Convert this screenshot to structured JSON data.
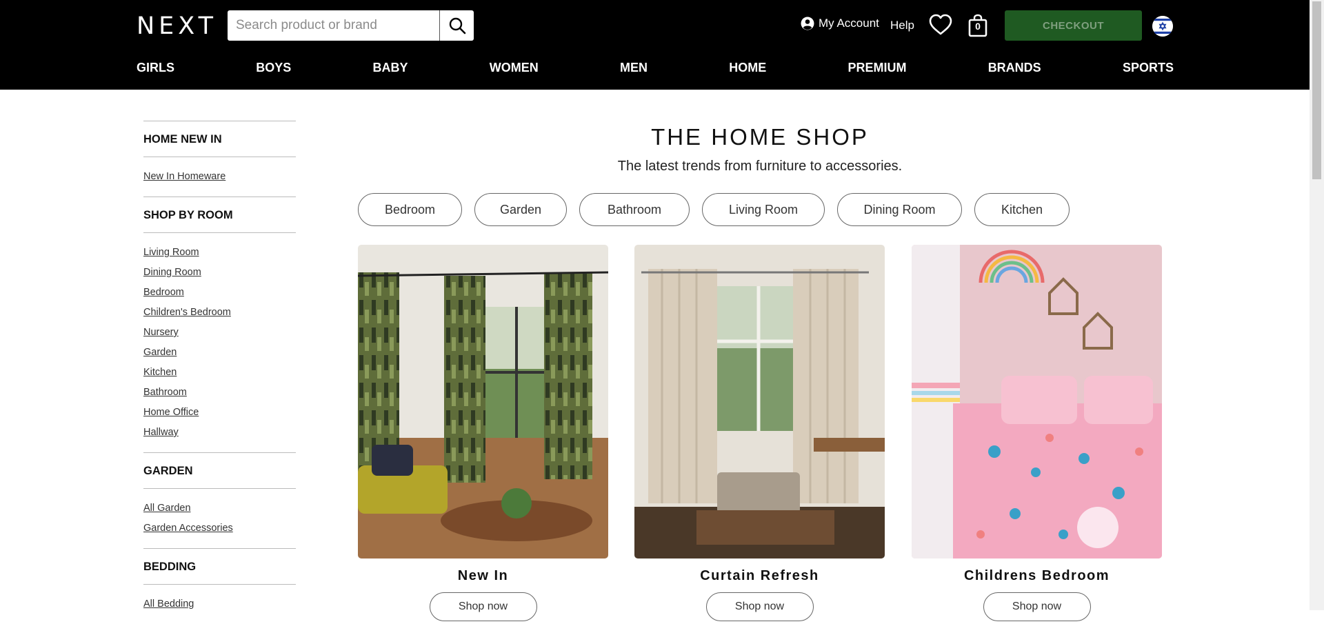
{
  "header": {
    "logo": "NEXT",
    "search_placeholder": "Search product or brand",
    "account_label": "My Account",
    "help_label": "Help",
    "bag_count": "0",
    "checkout_label": "CHECKOUT",
    "nav": [
      "GIRLS",
      "BOYS",
      "BABY",
      "WOMEN",
      "MEN",
      "HOME",
      "PREMIUM",
      "BRANDS",
      "SPORTS"
    ]
  },
  "sidebar": {
    "sections": [
      {
        "heading": "HOME NEW IN",
        "links": [
          "New In Homeware"
        ]
      },
      {
        "heading": "SHOP BY ROOM",
        "links": [
          "Living Room",
          "Dining Room",
          "Bedroom",
          "Children's Bedroom",
          "Nursery",
          "Garden",
          "Kitchen",
          "Bathroom",
          "Home Office",
          "Hallway"
        ]
      },
      {
        "heading": "GARDEN",
        "links": [
          "All Garden",
          "Garden Accessories"
        ]
      },
      {
        "heading": "BEDDING",
        "links": [
          "All Bedding"
        ]
      }
    ]
  },
  "main": {
    "title": "THE HOME SHOP",
    "subtitle": "The latest trends from furniture to accessories.",
    "chips": [
      "Bedroom",
      "Garden",
      "Bathroom",
      "Living Room",
      "Dining Room",
      "Kitchen"
    ],
    "cards": [
      {
        "title": "New In",
        "button": "Shop now"
      },
      {
        "title": "Curtain Refresh",
        "button": "Shop now"
      },
      {
        "title": "Childrens Bedroom",
        "button": "Shop now"
      }
    ]
  },
  "colors": {
    "header_bg": "#000000",
    "checkout_bg": "#1f5a22",
    "checkout_text": "#7f9f7f"
  }
}
